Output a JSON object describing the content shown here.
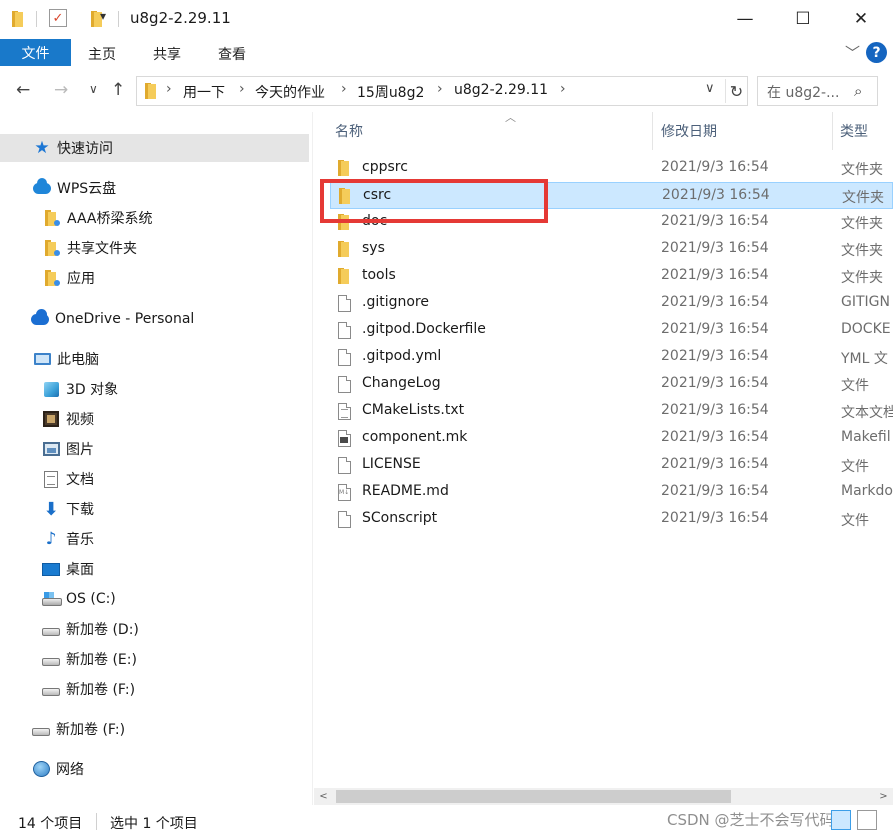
{
  "window": {
    "title": "u8g2-2.29.11",
    "minimize": "—",
    "maximize": "☐",
    "close": "✕"
  },
  "quick_access_toolbar": {
    "dropdown": "▾"
  },
  "ribbon": {
    "file_tab": "文件",
    "tabs": [
      "主页",
      "共享",
      "查看"
    ],
    "collapse": "﹀",
    "help": "?"
  },
  "nav": {
    "back": "←",
    "forward": "→",
    "recent": "∨",
    "up": "↑",
    "breadcrumb": [
      "用一下",
      "今天的作业",
      "15周u8g2",
      "u8g2-2.29.11"
    ],
    "separator": "›",
    "dropdown": "∨",
    "refresh": "↻",
    "search_placeholder": "在 u8g2-...",
    "search_icon": "⌕"
  },
  "sidebar": {
    "items": [
      {
        "label": "快速访问",
        "icon": "star-icon"
      },
      {
        "label": "WPS云盘",
        "icon": "cloud-icon"
      },
      {
        "label": "AAA桥梁系统",
        "icon": "folder-icon"
      },
      {
        "label": "共享文件夹",
        "icon": "folder-icon"
      },
      {
        "label": "应用",
        "icon": "folder-icon"
      },
      {
        "label": "OneDrive - Personal",
        "icon": "onedrive-icon"
      },
      {
        "label": "此电脑",
        "icon": "computer-icon"
      },
      {
        "label": "3D 对象",
        "icon": "3d-objects-icon"
      },
      {
        "label": "视频",
        "icon": "video-icon"
      },
      {
        "label": "图片",
        "icon": "pictures-icon"
      },
      {
        "label": "文档",
        "icon": "documents-icon"
      },
      {
        "label": "下载",
        "icon": "download-icon"
      },
      {
        "label": "音乐",
        "icon": "music-icon"
      },
      {
        "label": "桌面",
        "icon": "desktop-icon"
      },
      {
        "label": "OS (C:)",
        "icon": "windows-drive-icon"
      },
      {
        "label": "新加卷 (D:)",
        "icon": "drive-icon"
      },
      {
        "label": "新加卷 (E:)",
        "icon": "drive-icon"
      },
      {
        "label": "新加卷 (F:)",
        "icon": "drive-icon"
      },
      {
        "label": "新加卷 (F:)",
        "icon": "drive-icon"
      },
      {
        "label": "网络",
        "icon": "network-icon"
      }
    ]
  },
  "filelist": {
    "columns": {
      "name": "名称",
      "date": "修改日期",
      "type": "类型"
    },
    "rows": [
      {
        "name": "cppsrc",
        "date": "2021/9/3 16:54",
        "type": "文件夹",
        "icon": "folder-icon"
      },
      {
        "name": "csrc",
        "date": "2021/9/3 16:54",
        "type": "文件夹",
        "icon": "folder-icon",
        "selected": true
      },
      {
        "name": "doc",
        "date": "2021/9/3 16:54",
        "type": "文件夹",
        "icon": "folder-icon"
      },
      {
        "name": "sys",
        "date": "2021/9/3 16:54",
        "type": "文件夹",
        "icon": "folder-icon"
      },
      {
        "name": "tools",
        "date": "2021/9/3 16:54",
        "type": "文件夹",
        "icon": "folder-icon"
      },
      {
        "name": ".gitignore",
        "date": "2021/9/3 16:54",
        "type": "GITIGN",
        "icon": "file-icon"
      },
      {
        "name": ".gitpod.Dockerfile",
        "date": "2021/9/3 16:54",
        "type": "DOCKE",
        "icon": "file-icon"
      },
      {
        "name": ".gitpod.yml",
        "date": "2021/9/3 16:54",
        "type": "YML 文",
        "icon": "file-icon"
      },
      {
        "name": "ChangeLog",
        "date": "2021/9/3 16:54",
        "type": "文件",
        "icon": "file-icon"
      },
      {
        "name": "CMakeLists.txt",
        "date": "2021/9/3 16:54",
        "type": "文本文档",
        "icon": "text-file-icon"
      },
      {
        "name": "component.mk",
        "date": "2021/9/3 16:54",
        "type": "Makefil",
        "icon": "makefile-icon"
      },
      {
        "name": "LICENSE",
        "date": "2021/9/3 16:54",
        "type": "文件",
        "icon": "file-icon"
      },
      {
        "name": "README.md",
        "date": "2021/9/3 16:54",
        "type": "Markdo",
        "icon": "markdown-file-icon"
      },
      {
        "name": "SConscript",
        "date": "2021/9/3 16:54",
        "type": "文件",
        "icon": "file-icon"
      }
    ],
    "sort_indicator": "︿"
  },
  "scrollbar": {
    "left": "<",
    "right": ">"
  },
  "status": {
    "item_count": "14 个项目",
    "selection": "选中 1 个项目",
    "watermark": "CSDN @芝士不会写代码"
  },
  "colors": {
    "accent": "#1979ca",
    "selection_bg": "#cce8ff",
    "highlight_border": "#e53935",
    "folder": "#f2c451"
  }
}
